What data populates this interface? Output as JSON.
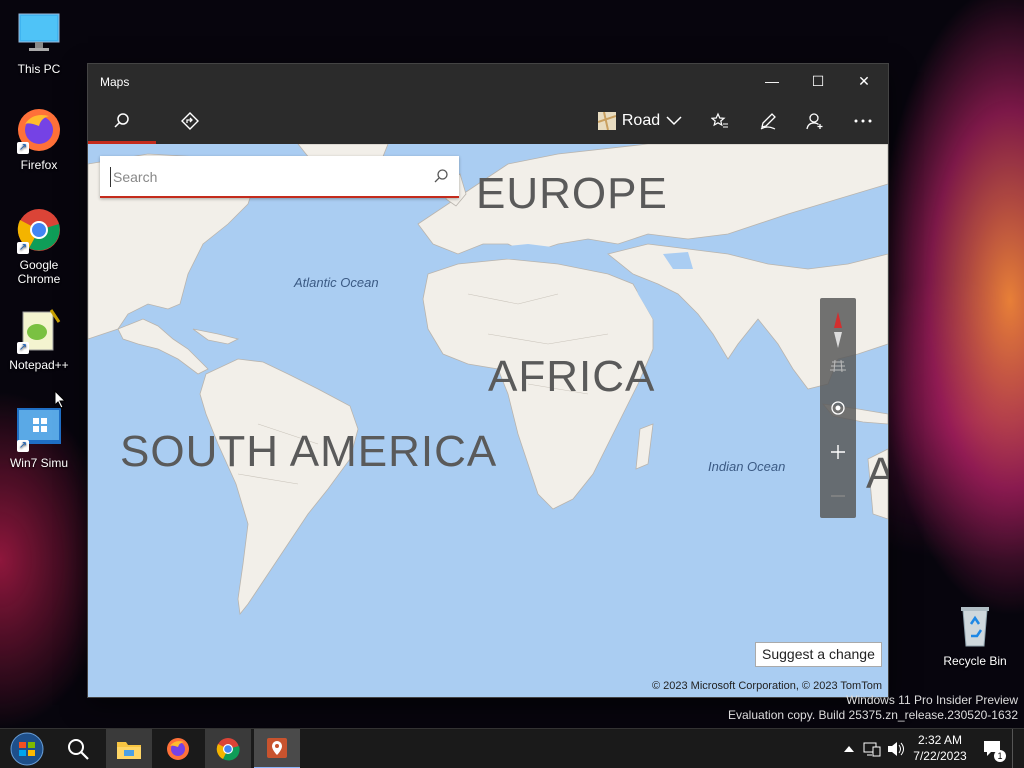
{
  "desktop": {
    "icons": [
      {
        "label": "This PC"
      },
      {
        "label": "Firefox"
      },
      {
        "label": "Google Chrome"
      },
      {
        "label": "Notepad++"
      },
      {
        "label": "Win7 Simu"
      },
      {
        "label": "Recycle Bin"
      }
    ]
  },
  "window": {
    "title": "Maps",
    "controls": {
      "minimize": "—",
      "maximize": "☐",
      "close": "✕"
    }
  },
  "toolbar": {
    "tabs": [
      {
        "name": "search",
        "icon": "search-icon",
        "selected": true
      },
      {
        "name": "directions",
        "icon": "directions-icon",
        "selected": false
      }
    ],
    "map_style": {
      "label": "Road",
      "icon": "map-style-icon"
    },
    "actions": [
      "favorites-icon",
      "ink-pen-icon",
      "account-icon",
      "more-icon"
    ]
  },
  "search": {
    "placeholder": "Search",
    "value": ""
  },
  "map": {
    "continent_labels": [
      "EUROPE",
      "AFRICA",
      "SOUTH AMERICA",
      "AU"
    ],
    "ocean_labels": [
      "Atlantic Ocean",
      "Indian Ocean"
    ],
    "suggest_button": "Suggest a change",
    "copyright": "© 2023 Microsoft Corporation, © 2023 TomTom"
  },
  "watermark": {
    "line1": "Windows 11 Pro Insider Preview",
    "line2": "Evaluation copy. Build 25375.zn_release.230520-1632"
  },
  "taskbar": {
    "items": [
      "start-button",
      "search-icon",
      "file-explorer-icon",
      "firefox-icon",
      "chrome-icon",
      "maps-icon"
    ],
    "clock": {
      "time": "2:32 AM",
      "date": "7/22/2023"
    },
    "notification_count": "1"
  },
  "colors": {
    "accent": "#c42b1c",
    "ocean": "#aacdf2",
    "land": "#f2efe9"
  }
}
